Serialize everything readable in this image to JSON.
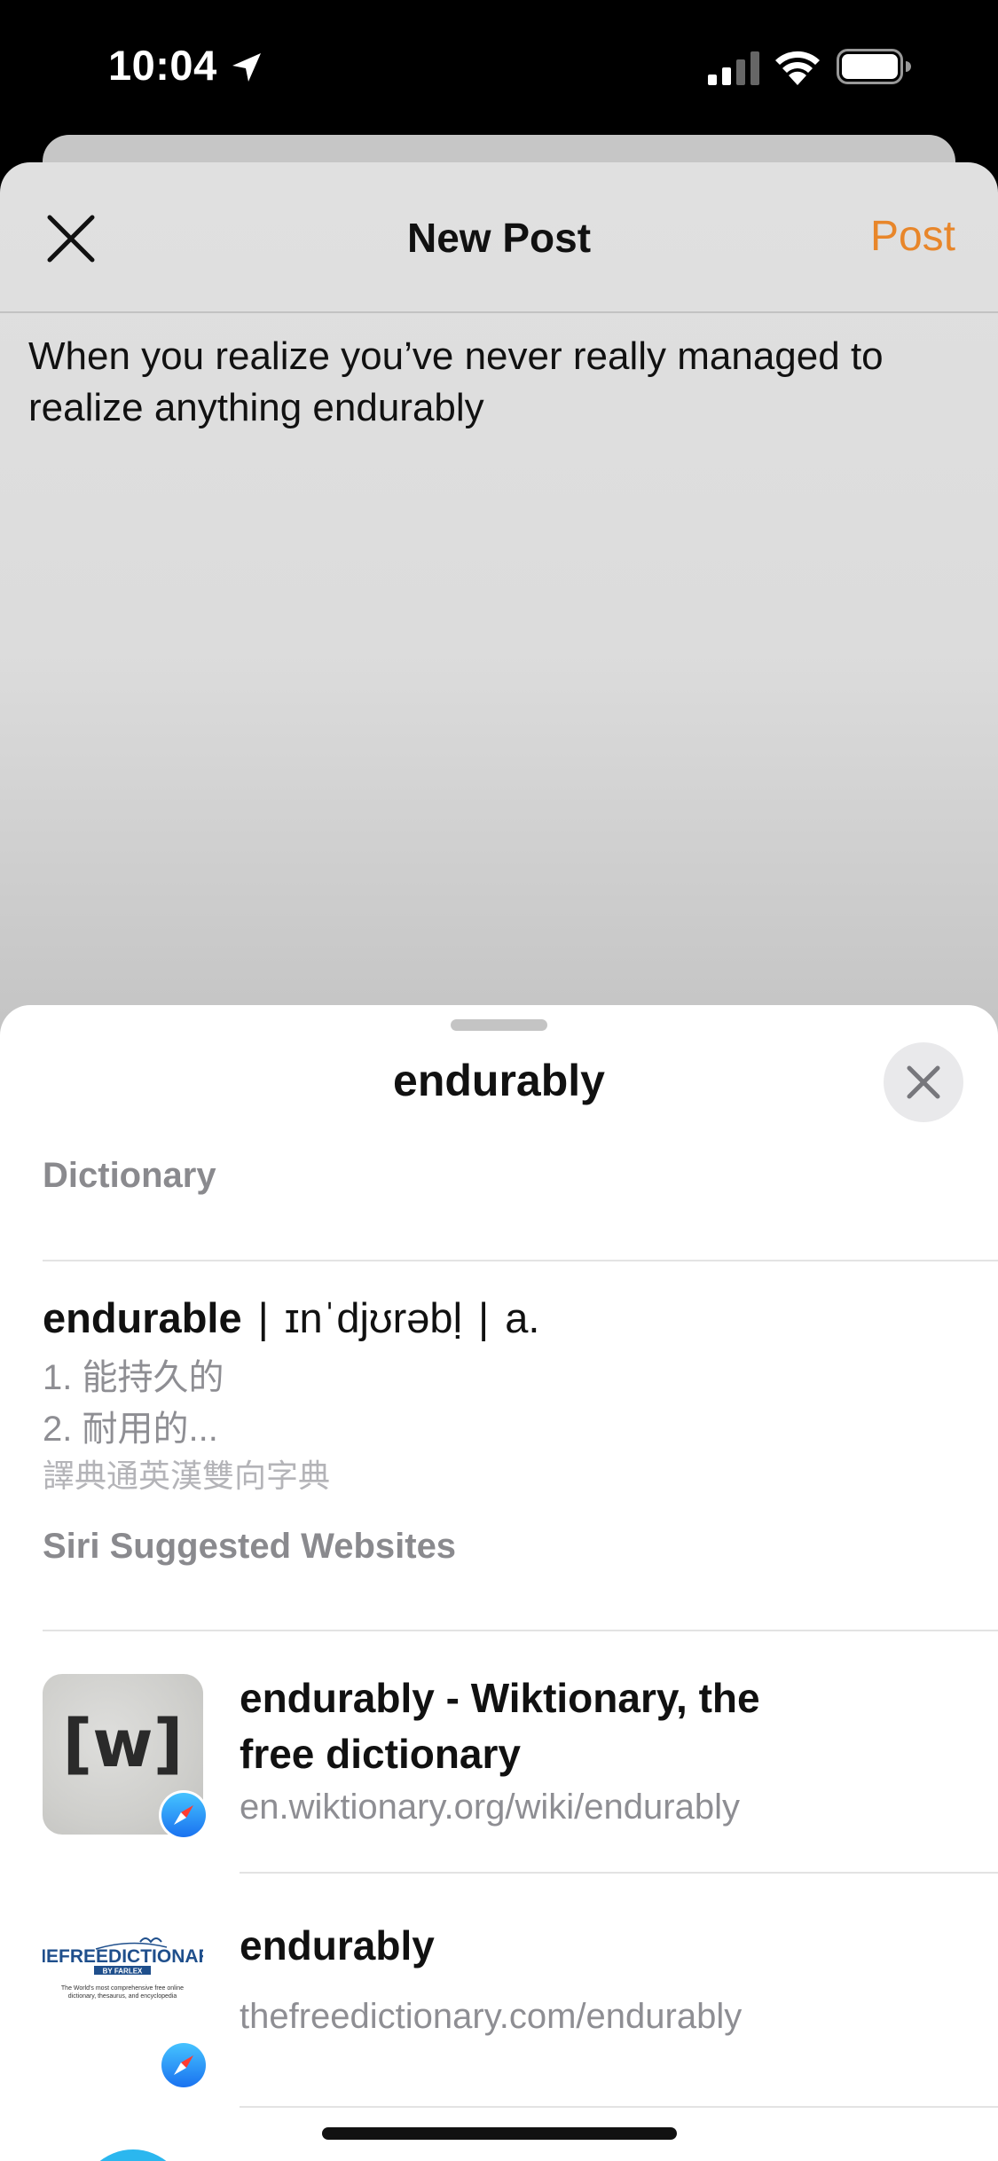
{
  "status_bar": {
    "time": "10:04"
  },
  "compose": {
    "title": "New Post",
    "post_label": "Post",
    "text": "When you realize you’ve never really managed to realize anything endurably"
  },
  "lookup": {
    "title": "endurably",
    "dictionary": {
      "header": "Dictionary",
      "word": "endurable",
      "sep1": "|",
      "pronunciation": "ɪnˈdjʊrəbḷ",
      "sep2": "|",
      "pos": "a.",
      "definitions": [
        "1. 能持久的",
        "2. 耐用的..."
      ],
      "source": "譯典通英漢雙向字典"
    },
    "siri": {
      "header": "Siri Suggested Websites",
      "results": [
        {
          "title_line1": "endurably - Wiktionary, the",
          "title_line2": "free dictionary",
          "url": "en.wiktionary.org/wiki/endurably",
          "thumb_text": "[w]",
          "icon": "wiktionary-icon"
        },
        {
          "title_line1": "endurably",
          "url": "thefreedictionary.com/endurably",
          "logo_main": "THEFREEDICTIONARY",
          "logo_sub": "BY FARLEX",
          "logo_tagline": "The World's most comprehensive free online dictionary, thesaurus, and encyclopedia",
          "icon": "thefreedictionary-icon"
        }
      ]
    }
  },
  "colors": {
    "accent": "#e8862a",
    "secondary_text": "#8e8e93",
    "panel_bg": "#ffffff"
  }
}
